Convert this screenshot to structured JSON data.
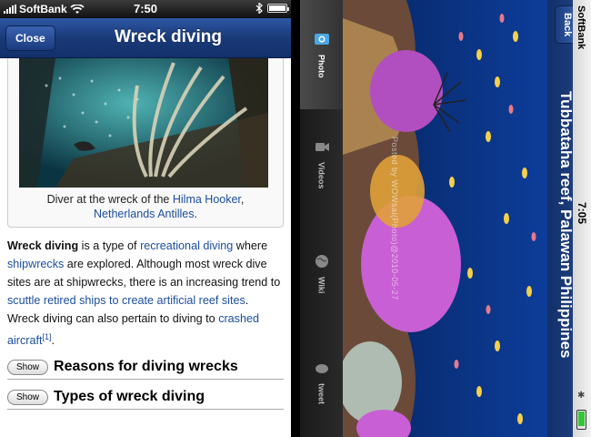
{
  "left": {
    "status": {
      "carrier": "SoftBank",
      "time": "7:50"
    },
    "navbar": {
      "close_label": "Close",
      "title": "Wreck diving"
    },
    "figure": {
      "caption_prefix": "Diver at the wreck of the ",
      "caption_link1": "Hilma Hooker",
      "caption_sep": ",",
      "caption_link2": "Netherlands Antilles",
      "caption_end": "."
    },
    "intro": {
      "bold": "Wreck diving",
      "t1": " is a type of ",
      "l1": "recreational diving",
      "t2": " where ",
      "l2": "shipwrecks",
      "t3": " are explored. Although most wreck dive sites are at shipwrecks, there is an increasing trend to ",
      "l3": "scuttle retired ships to create artificial reef sites",
      "t4": ". Wreck diving can also pertain to diving to ",
      "l4": "crashed aircraft",
      "ref": "[1]",
      "t5": "."
    },
    "sections": [
      {
        "button": "Show",
        "title": "Reasons for diving wrecks"
      },
      {
        "button": "Show",
        "title": "Types of wreck diving"
      }
    ]
  },
  "right": {
    "status": {
      "carrier": "SoftBank",
      "time": "7:05"
    },
    "back_label": "Back",
    "title": "Tubbataha reef, Palawan Philippines",
    "credit": "Posted by WOWsai(Photo)@2010-05-27",
    "tabs": [
      {
        "label": "Photo",
        "icon": "photo-icon"
      },
      {
        "label": "Videos",
        "icon": "video-camera-icon"
      },
      {
        "label": "Wiki",
        "icon": "globe-icon"
      },
      {
        "label": "tweet",
        "icon": "bird-icon"
      }
    ],
    "battery_level": 0.9
  },
  "colors": {
    "nav_blue": "#1a3a78",
    "link_blue": "#1c4ea0"
  }
}
